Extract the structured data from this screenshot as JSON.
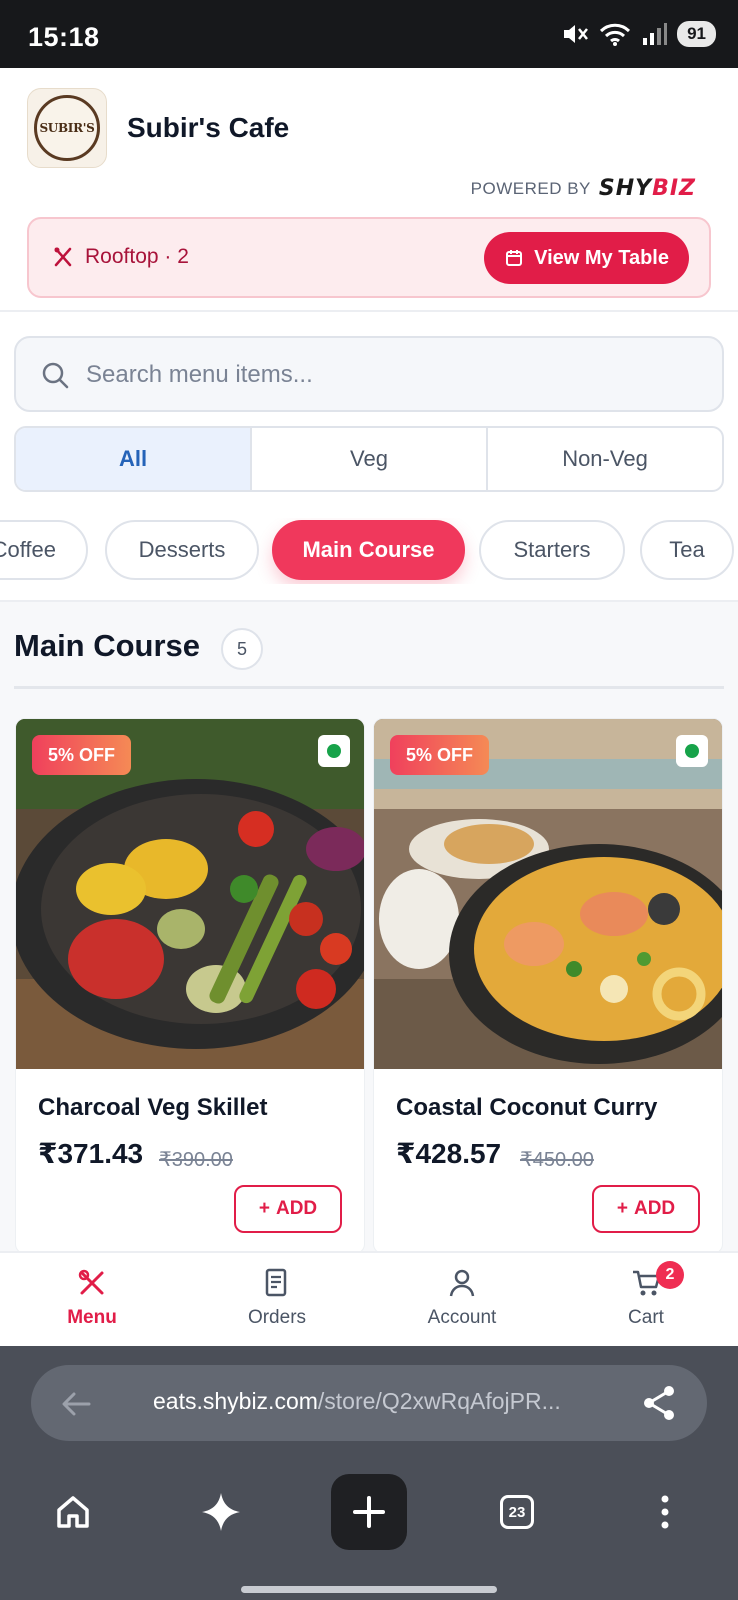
{
  "status_bar": {
    "time": "15:18",
    "battery": "91"
  },
  "header": {
    "logo_text": "SUBIR'S",
    "cafe_name": "Subir's Cafe",
    "powered_by_label": "POWERED BY",
    "brand_part1": "SHY",
    "brand_part2": "BIZ"
  },
  "table_banner": {
    "location": "Rooftop · 2",
    "button_label": "View My Table"
  },
  "search": {
    "placeholder": "Search menu items..."
  },
  "diet_filter": {
    "options": [
      "All",
      "Veg",
      "Non-Veg"
    ],
    "selected": "All"
  },
  "categories": {
    "items": [
      "Coffee",
      "Desserts",
      "Main Course",
      "Starters",
      "Tea"
    ],
    "selected": "Main Course"
  },
  "section": {
    "title": "Main Course",
    "count": "5"
  },
  "dishes": [
    {
      "name": "Charcoal Veg Skillet",
      "price": "₹371.43",
      "original_price": "₹390.00",
      "discount": "5% OFF",
      "add_label": "ADD",
      "veg": true
    },
    {
      "name": "Coastal Coconut Curry",
      "price": "₹428.57",
      "original_price": "₹450.00",
      "discount": "5% OFF",
      "add_label": "ADD",
      "veg": true
    }
  ],
  "bottom_nav": {
    "items": [
      "Menu",
      "Orders",
      "Account",
      "Cart"
    ],
    "active": "Menu",
    "cart_badge": "2"
  },
  "browser": {
    "url_domain": "eats.shybiz.com",
    "url_path": "/store/Q2xwRqAfojPR...",
    "tab_count": "23"
  },
  "colors": {
    "accent": "#e11d48",
    "chip_active": "#f0385c",
    "segment_active_bg": "#eaf1fd",
    "segment_active_text": "#2563b8",
    "veg_dot": "#17a34a"
  }
}
